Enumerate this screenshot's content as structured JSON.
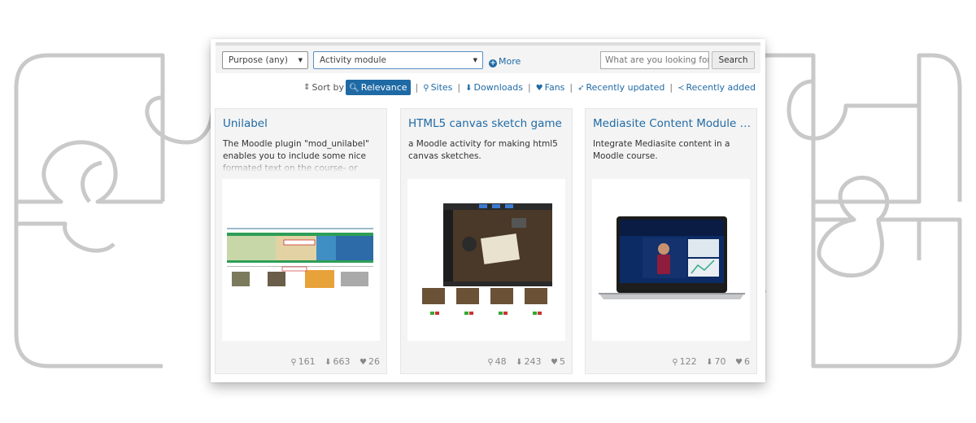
{
  "filters": {
    "purpose": "Purpose (any)",
    "type": "Activity module",
    "more": "More",
    "search_placeholder": "What are you looking for?",
    "search_button": "Search"
  },
  "sort": {
    "label": "Sort by",
    "options": [
      "Relevance",
      "Sites",
      "Downloads",
      "Fans",
      "Recently updated",
      "Recently added"
    ],
    "active": "Relevance"
  },
  "plugins": [
    {
      "title": "Unilabel",
      "description": "The Moodle plugin \"mod_unilabel\" enables you to include some nice formated text on the course- or",
      "sites": "161",
      "downloads": "663",
      "fans": "26"
    },
    {
      "title": "HTML5 canvas sketch game",
      "description": "a Moodle activity for making html5 canvas sketches.",
      "sites": "48",
      "downloads": "243",
      "fans": "5"
    },
    {
      "title": "Mediasite Content Module for...",
      "description": "Integrate Mediasite content in a Moodle course.",
      "sites": "122",
      "downloads": "70",
      "fans": "6"
    }
  ],
  "colors": {
    "link": "#1f6aa5",
    "puzzle": "#c9c9c9"
  },
  "icons": [
    "chevron-down-icon",
    "plus-circle-icon",
    "sort-icon",
    "search-icon",
    "map-marker-icon",
    "download-icon",
    "heart-icon",
    "rocket-icon",
    "share-icon"
  ]
}
